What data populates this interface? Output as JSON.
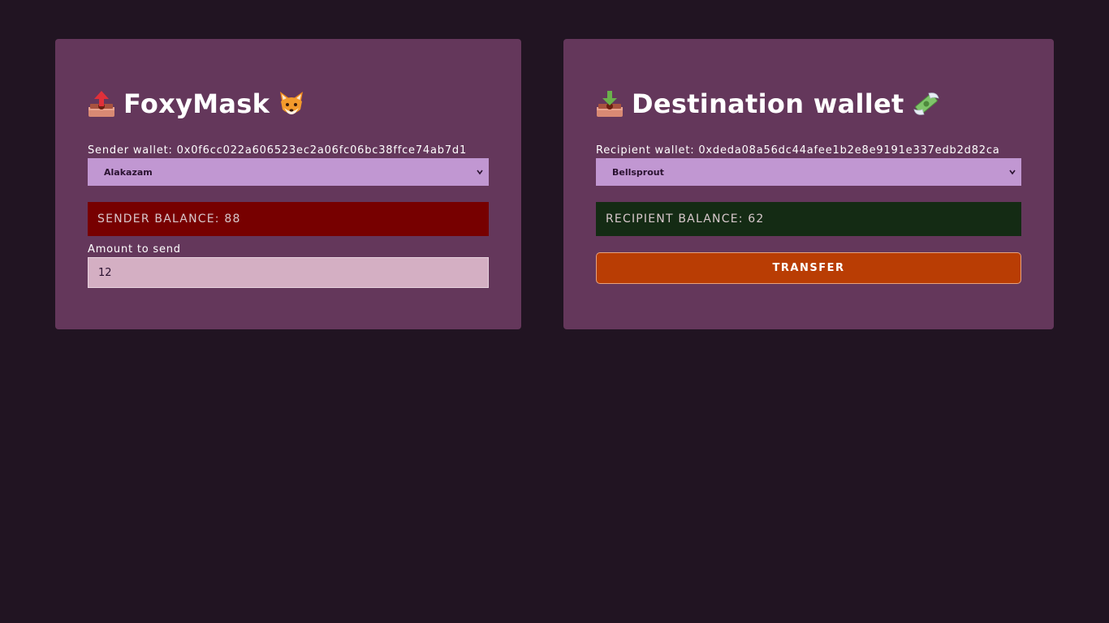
{
  "sender": {
    "title": "FoxyMask",
    "title_icon_left": "outbox-tray-icon",
    "title_icon_right": "fox-icon",
    "wallet_label": "Sender wallet: 0x0f6cc022a606523ec2a06fc06bc38ffce74ab7d1",
    "selected_wallet": "Alakazam",
    "balance_text": "SENDER BALANCE: 88",
    "amount_label": "Amount to send",
    "amount_value": "12"
  },
  "recipient": {
    "title": "Destination wallet",
    "title_icon_left": "inbox-tray-icon",
    "title_icon_right": "money-with-wings-icon",
    "wallet_label": "Recipient wallet: 0xdeda08a56dc44afee1b2e8e9191e337edb2d82ca",
    "selected_wallet": "Bellsprout",
    "balance_text": "RECIPIENT BALANCE: 62",
    "transfer_label": "TRANSFER"
  },
  "colors": {
    "page_background": "#211422",
    "card_background": "#64375b",
    "select_background": "#c197d2",
    "sender_balance_background": "#770000",
    "recipient_balance_background": "#142b14",
    "input_background": "#d4afc3",
    "transfer_button": "#b93d04"
  }
}
